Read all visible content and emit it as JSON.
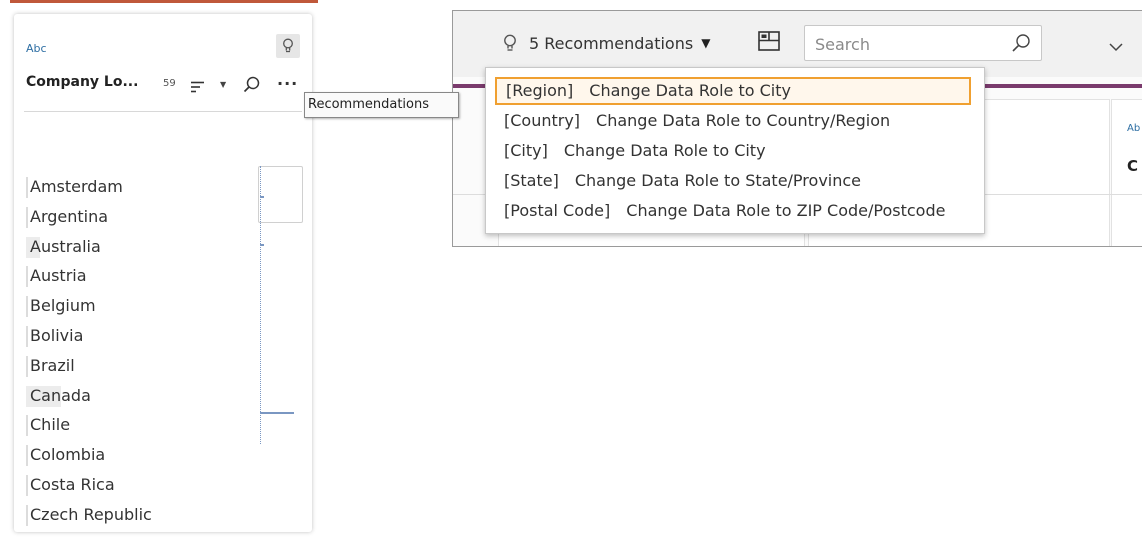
{
  "profile_card": {
    "type_label": "Abc",
    "field_name": "Company Lo...",
    "value_count": "59",
    "values": [
      {
        "label": "Amsterdam",
        "fill": 0.0
      },
      {
        "label": "Argentina",
        "fill": 0.0
      },
      {
        "label": "Australia",
        "fill": 0.14
      },
      {
        "label": "Austria",
        "fill": 0.0
      },
      {
        "label": "Belgium",
        "fill": 0.0
      },
      {
        "label": "Bolivia",
        "fill": 0.0
      },
      {
        "label": "Brazil",
        "fill": 0.0
      },
      {
        "label": "Canada",
        "fill": 0.35
      },
      {
        "label": "Chile",
        "fill": 0.0
      },
      {
        "label": "Colombia",
        "fill": 0.0
      },
      {
        "label": "Costa Rica",
        "fill": 0.0
      },
      {
        "label": "Czech Republic",
        "fill": 0.0
      }
    ]
  },
  "tooltip": {
    "text": "Recommendations"
  },
  "toolbar": {
    "recommendations_label": "5 Recommendations",
    "search_placeholder": "Search"
  },
  "background": {
    "clip_type": "Ab",
    "clip_name": "C"
  },
  "recommendations": [
    {
      "field": "[Region]",
      "action": "Change Data Role to City",
      "selected": true
    },
    {
      "field": "[Country]",
      "action": "Change Data Role to Country/Region",
      "selected": false
    },
    {
      "field": "[City]",
      "action": "Change Data Role to City",
      "selected": false
    },
    {
      "field": "[State]",
      "action": "Change Data Role to State/Province",
      "selected": false
    },
    {
      "field": "[Postal Code]",
      "action": "Change Data Role to ZIP Code/Postcode",
      "selected": false
    }
  ],
  "colors": {
    "accent_purple": "#7a3b6d",
    "selection_border": "#f0a030",
    "type_blue": "#2d6ea3"
  },
  "icons": [
    "lightbulb-icon",
    "sort-icon",
    "search-icon",
    "more-icon",
    "dropdown-caret-icon",
    "layout-icon",
    "chevron-down-icon"
  ]
}
